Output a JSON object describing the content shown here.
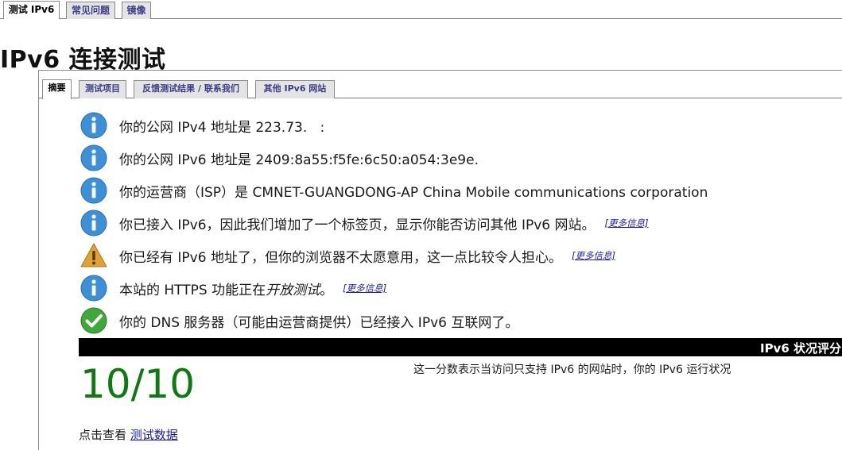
{
  "top_tabs": [
    {
      "label": "测试 IPv6"
    },
    {
      "label": "常见问题"
    },
    {
      "label": "镜像"
    }
  ],
  "page_title": "IPv6 连接测试",
  "sub_tabs": [
    {
      "label": "摘要"
    },
    {
      "label": "测试项目"
    },
    {
      "label": "反馈测试结果 / 联系我们"
    },
    {
      "label": "其他 IPv6 网站"
    }
  ],
  "info_rows": [
    {
      "icon": "info-icon",
      "text": "你的公网 IPv4 地址是 223.73.   :   "
    },
    {
      "icon": "info-icon",
      "text": "你的公网 IPv6 地址是 2409:8a55:f5fe:6c50:a054:3e9e.       "
    },
    {
      "icon": "info-icon",
      "text": "你的运营商（ISP）是 CMNET-GUANGDONG-AP China Mobile communications corporation"
    },
    {
      "icon": "info-icon",
      "text": "你已接入 IPv6，因此我们增加了一个标签页，显示你能否访问其他 IPv6 网站。",
      "more": "[更多信息]"
    },
    {
      "icon": "warning-icon",
      "text": "你已经有 IPv6 地址了，但你的浏览器不太愿意用，这一点比较令人担心。",
      "more": "[更多信息]"
    },
    {
      "icon": "info-icon",
      "text_before": "本站的 HTTPS 功能正在",
      "text_em": "开放测试",
      "text_after": "。",
      "more": "[更多信息]"
    },
    {
      "icon": "checkmark-icon",
      "text": "你的 DNS 服务器（可能由运营商提供）已经接入 IPv6 互联网了。"
    }
  ],
  "score": {
    "label": "IPv6 状况评分",
    "value": "10/10",
    "description": "这一分数表示当访问只支持 IPv6 的网站时，你的 IPv6 运行状况"
  },
  "footer": {
    "text": "点击查看",
    "link": "测试数据"
  },
  "colors": {
    "info_icon": "#3d8fd6",
    "warning_icon": "#e0a232",
    "check_icon": "#3fa83a",
    "score": "#0f7a0f",
    "link": "#1a1aa6"
  }
}
